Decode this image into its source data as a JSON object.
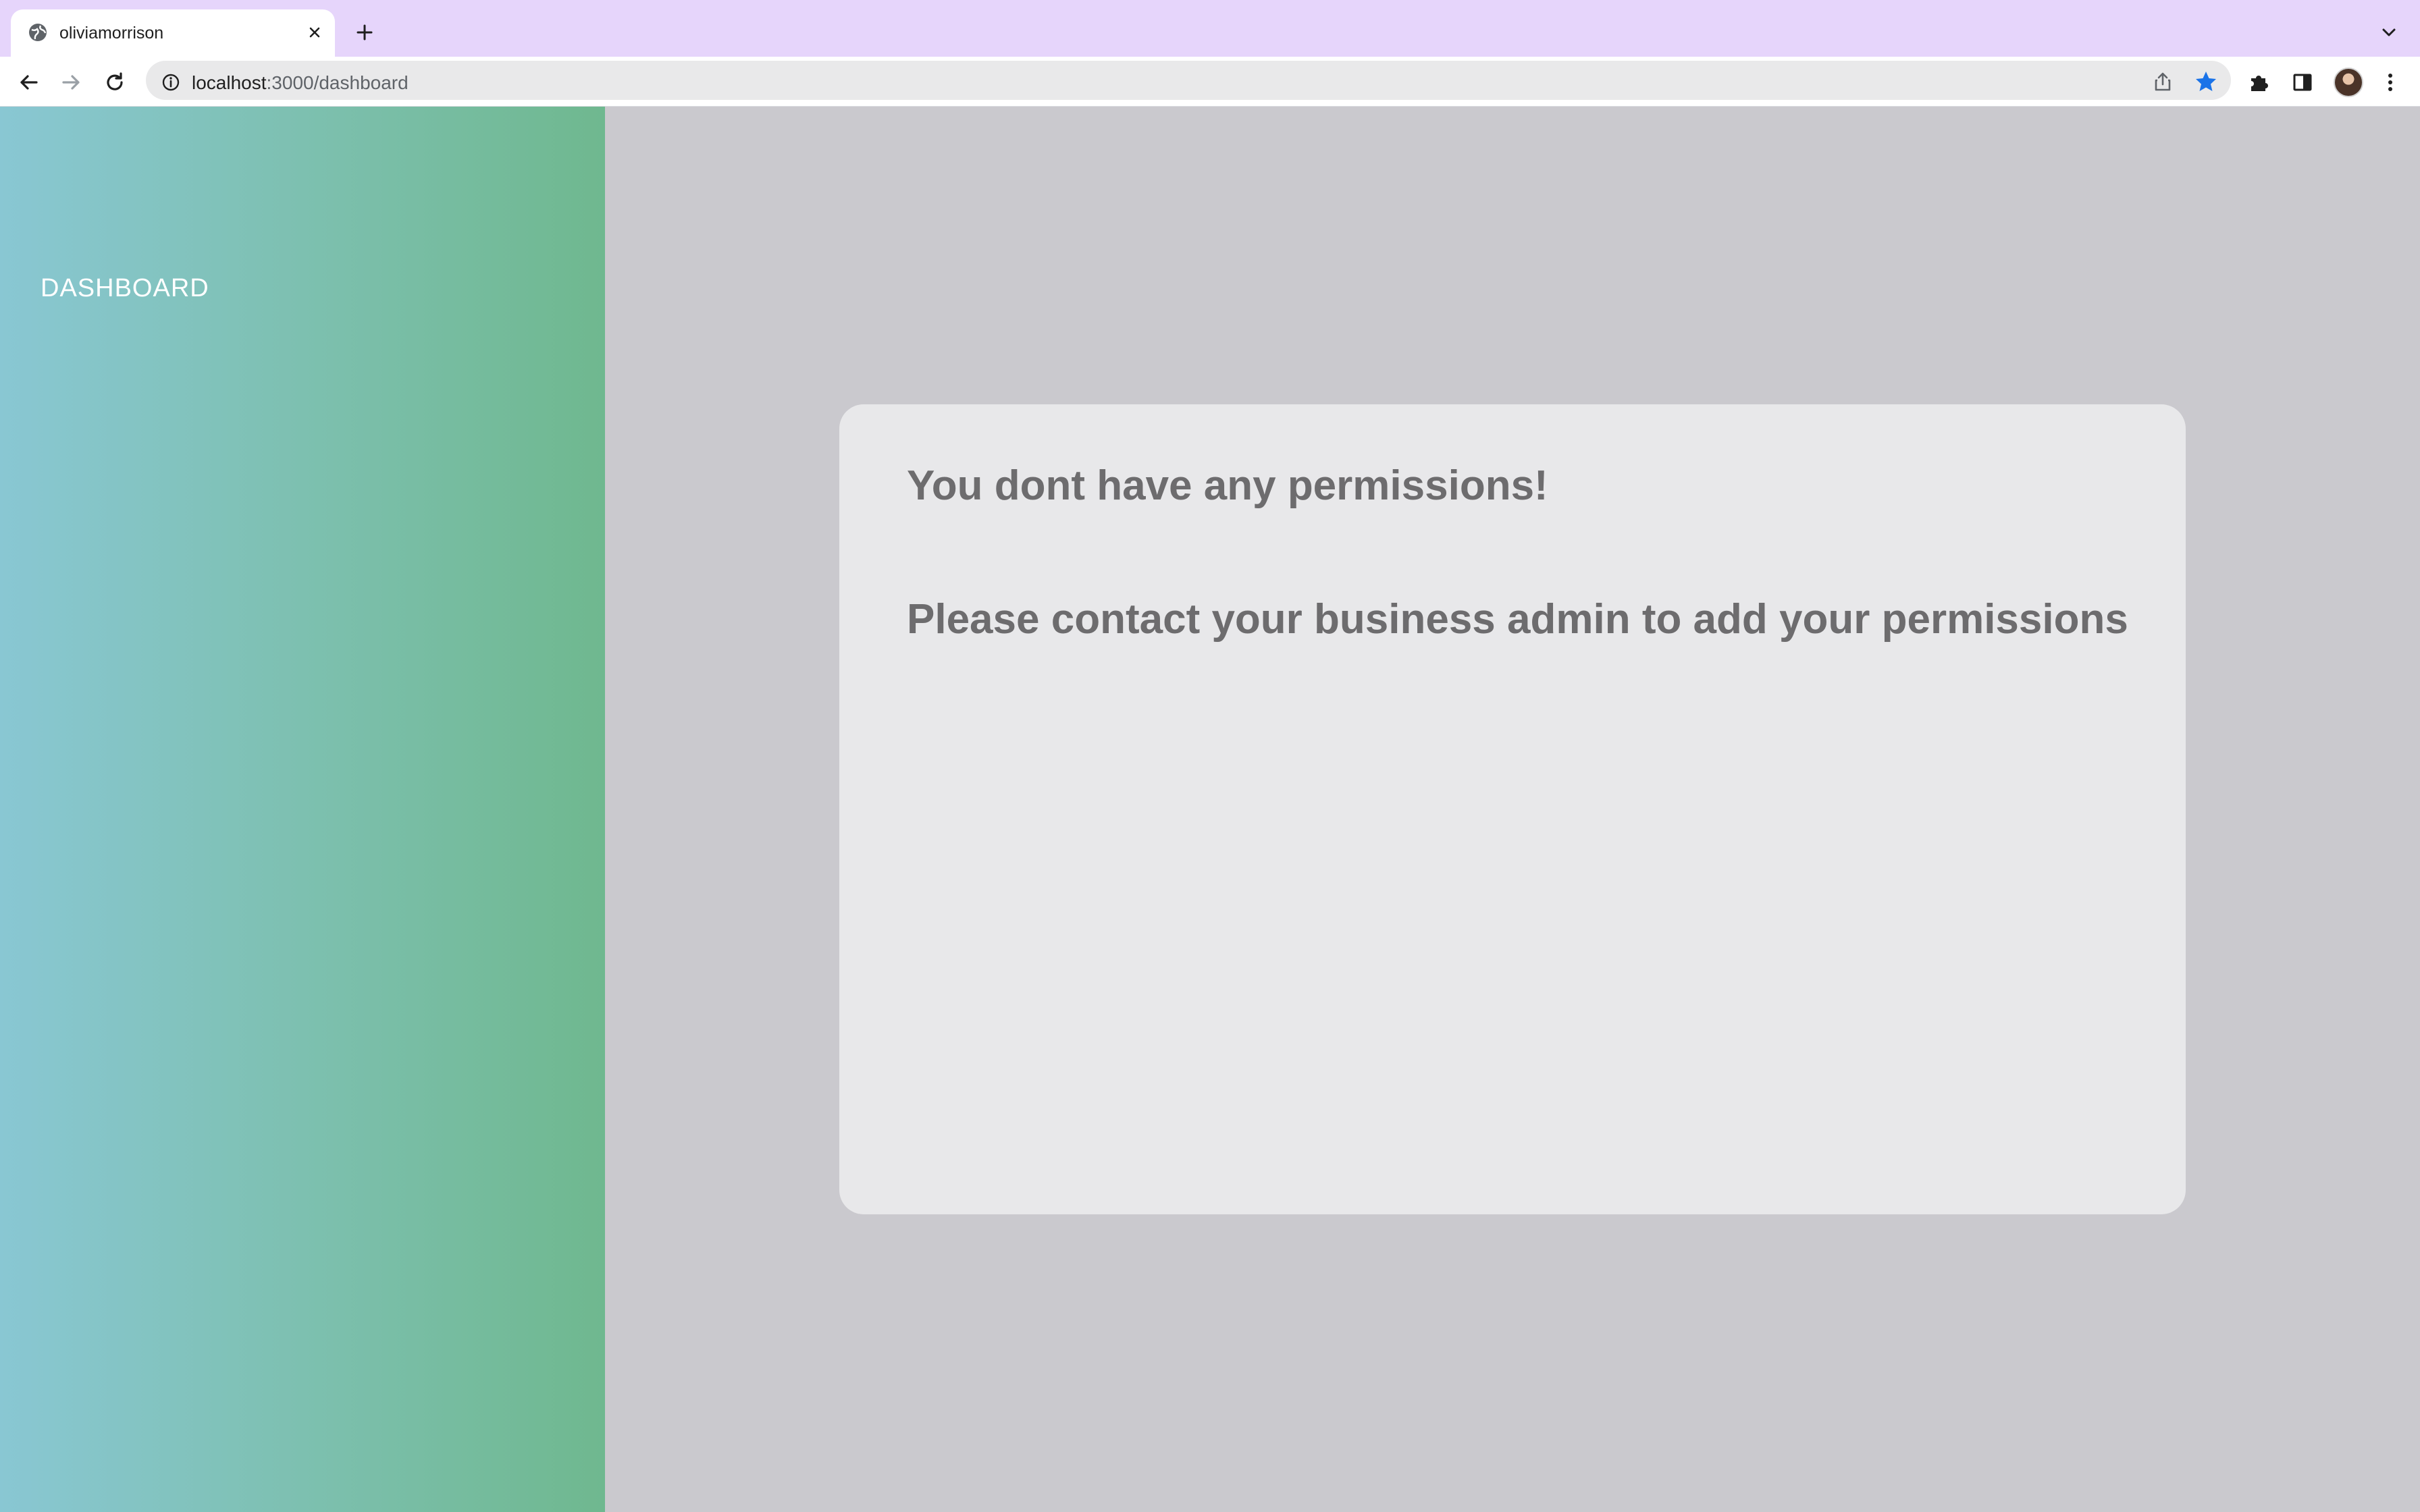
{
  "browser": {
    "tab": {
      "title": "oliviamorrison",
      "favicon": "globe-icon"
    },
    "address_bar": {
      "host": "localhost",
      "path": ":3000/dashboard"
    },
    "colors": {
      "tabstrip": "#e6d5fb",
      "star": "#1a73e8"
    }
  },
  "sidebar": {
    "nav_item": "DASHBOARD",
    "gradient": [
      "#89c7d3",
      "#6fb88f"
    ]
  },
  "main": {
    "card": {
      "title": "You dont have any permissions!",
      "message": "Please contact your business admin to add your permissions"
    }
  }
}
